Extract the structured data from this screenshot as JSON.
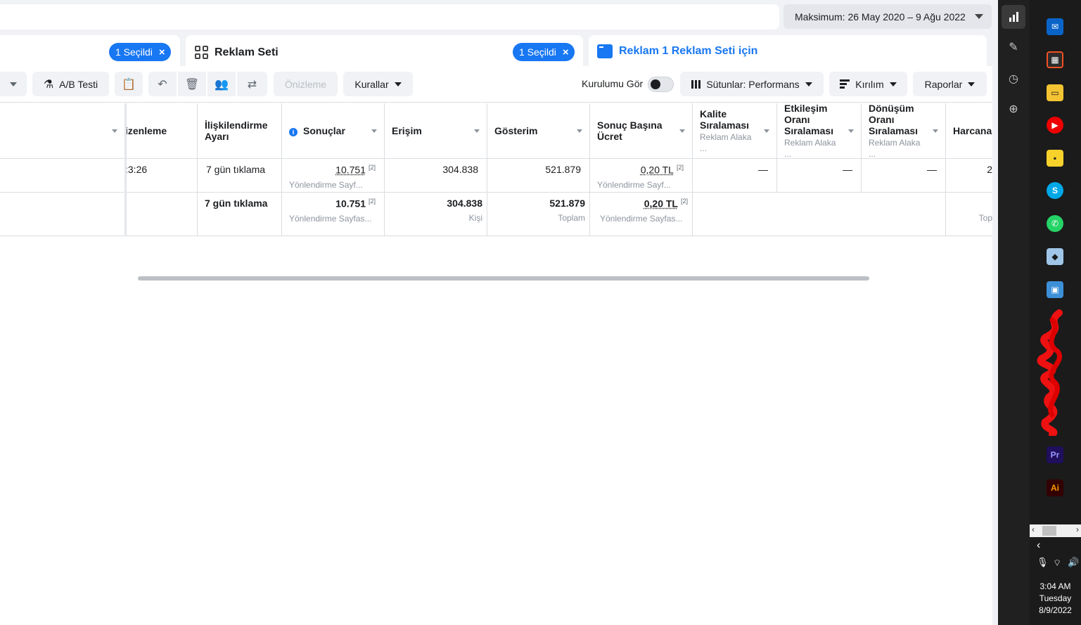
{
  "header": {
    "date_range": "Maksimum: 26 May 2020 – 9 Ağu 2022"
  },
  "tabs": [
    {
      "selected_label": "1 Seçildi",
      "close": "×"
    },
    {
      "title": "Reklam Seti",
      "selected_label": "1 Seçildi",
      "close": "×"
    },
    {
      "title": "Reklam 1 Reklam Seti için"
    }
  ],
  "toolbar": {
    "ab_test": "A/B Testi",
    "preview": "Önizleme",
    "rules": "Kurallar",
    "setup_label": "Kurulumu Gör",
    "columns": "Sütunlar: Performans",
    "breakdown": "Kırılım",
    "reports": "Raporlar"
  },
  "table": {
    "headers": {
      "editing": "izenleme",
      "attribution": "İlişkilendirme Ayarı",
      "results": "Sonuçlar",
      "reach": "Erişim",
      "impressions": "Gösterim",
      "cpr": "Sonuç Başına Ücret",
      "quality": "Kalite Sıralaması",
      "quality_sub": "Reklam Alaka ...",
      "engagement": "Etkileşim Oranı Sıralaması",
      "engagement_sub": "Reklam Alaka ...",
      "conversion": "Dönüşüm Oranı Sıralaması",
      "conversion_sub": "Reklam Alaka ...",
      "spent": "Harcanan"
    },
    "row1": {
      "time": ":3:26",
      "attribution": "7 gün tıklama",
      "results": "10.751",
      "results_sup": "[2]",
      "results_sub": "Yönlendirme Sayf...",
      "reach": "304.838",
      "impressions": "521.879",
      "cpr": "0,20 TL",
      "cpr_sup": "[2]",
      "cpr_sub": "Yönlendirme Sayf...",
      "quality": "—",
      "engagement": "—",
      "conversion": "—",
      "spent": "2"
    },
    "row2": {
      "attribution": "7 gün tıklama",
      "results": "10.751",
      "results_sup": "[2]",
      "results_sub": "Yönlendirme Sayfas...",
      "reach": "304.838",
      "reach_sub": "Kişi",
      "impressions": "521.879",
      "impressions_sub": "Toplam",
      "cpr": "0,20 TL",
      "cpr_sup": "[2]",
      "cpr_sub": "Yönlendirme Sayfas...",
      "spent_sub": "Top"
    }
  },
  "taskbar": {
    "icons": [
      "mail-icon",
      "store-icon",
      "file-explorer-icon",
      "youtube-icon",
      "sticky-notes-icon",
      "skype-icon",
      "whatsapp-icon",
      "eraser-app-icon",
      "control-panel-icon",
      "premiere-icon",
      "illustrator-icon"
    ],
    "premiere": "Pr",
    "illustrator": "Ai",
    "skype": "S",
    "time": "3:04 AM",
    "day": "Tuesday",
    "date": "8/9/2022"
  },
  "colors": {
    "accent": "#1877f2",
    "background": "#f0f2f5"
  }
}
